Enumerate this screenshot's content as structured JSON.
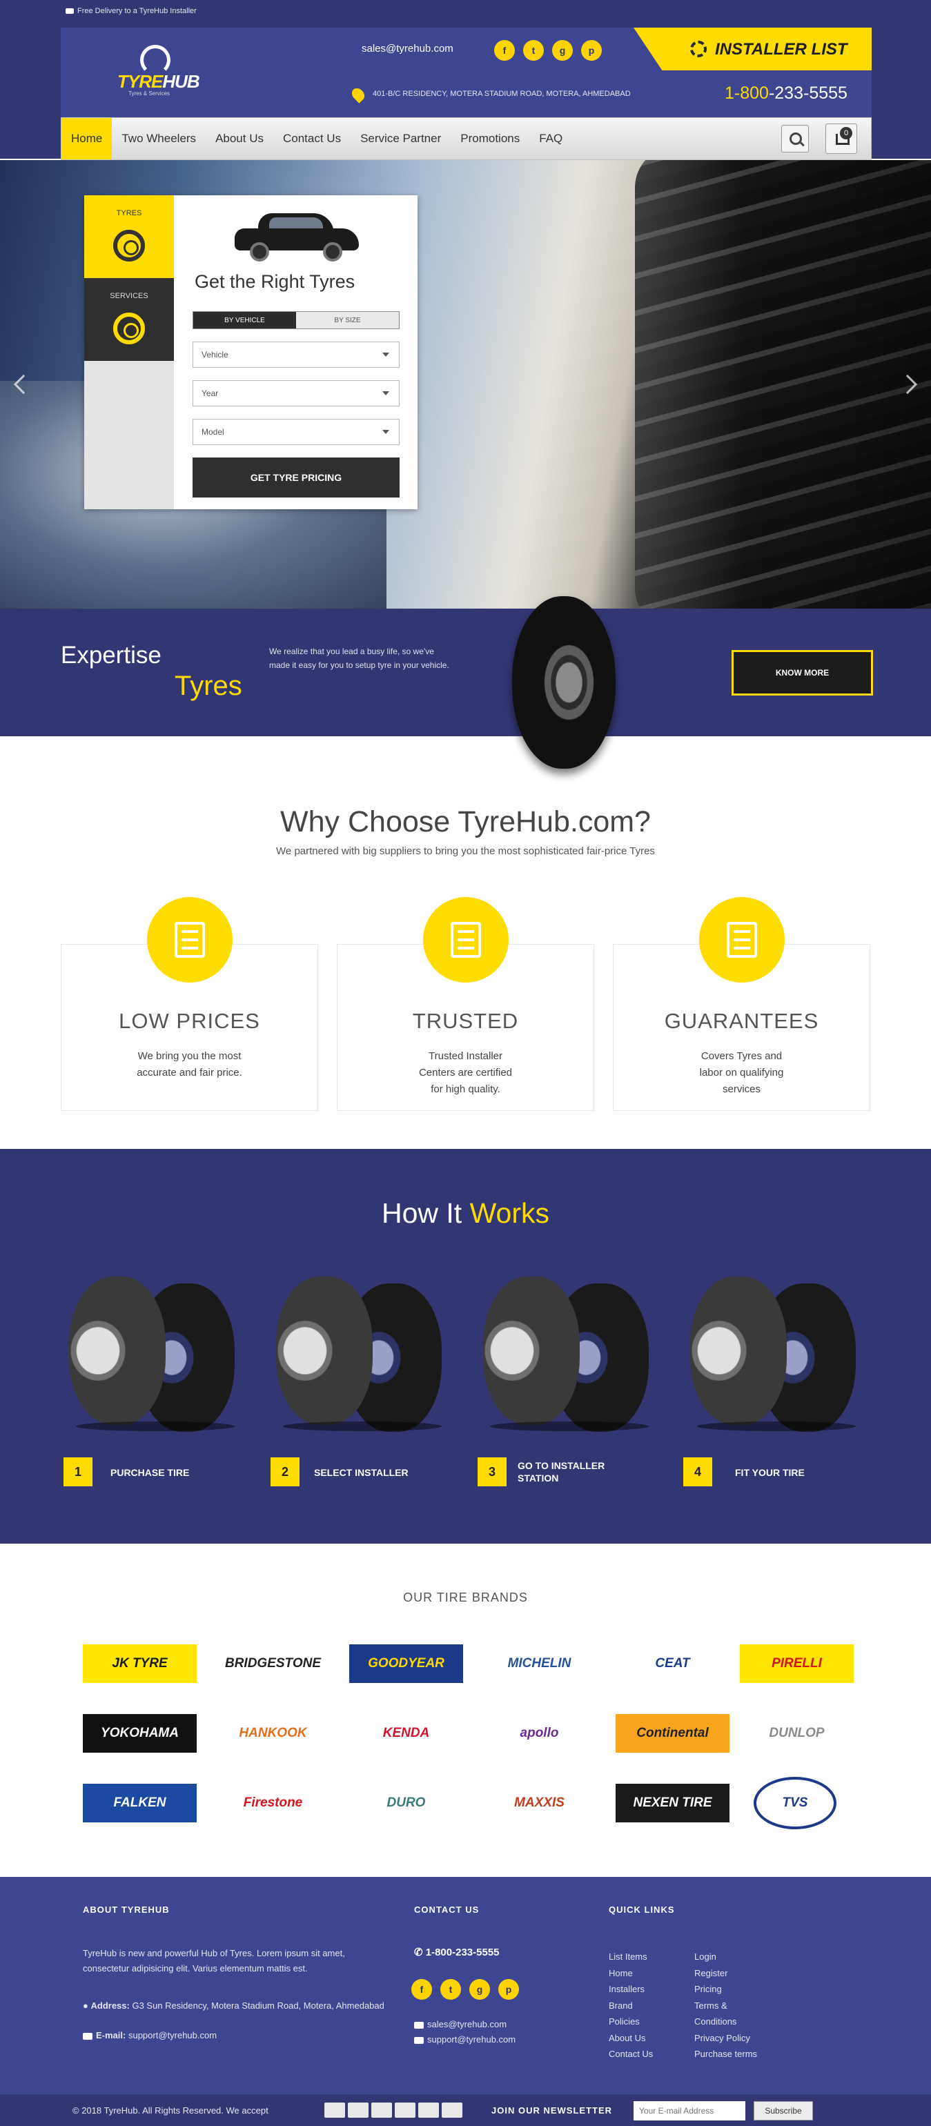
{
  "topbar": {
    "notice": "Free Delivery to a TyreHub Installer"
  },
  "header": {
    "logo_text_a": "TYRE",
    "logo_text_b": "HUB",
    "logo_tagline": "Tyres & Services",
    "email": "sales@tyrehub.com",
    "social": [
      {
        "icon": "facebook-icon",
        "glyph": "f"
      },
      {
        "icon": "twitter-icon",
        "glyph": "t"
      },
      {
        "icon": "google-plus-icon",
        "glyph": "g"
      },
      {
        "icon": "pinterest-icon",
        "glyph": "p"
      }
    ],
    "installer_label": "INSTALLER LIST",
    "address": "401-B/C RESIDENCY, MOTERA STADIUM ROAD, MOTERA, AHMEDABAD",
    "phone_prefix": "1-800",
    "phone_rest": "-233-5555"
  },
  "nav": {
    "items": [
      "Home",
      "Two Wheelers",
      "About Us",
      "Contact Us",
      "Service Partner",
      "Promotions",
      "FAQ"
    ],
    "active": "Home",
    "cart_count": "0"
  },
  "finder": {
    "tab_tyres": "TYRES",
    "tab_services": "SERVICES",
    "title": "Get the Right Tyres",
    "seg_vehicle": "BY VEHICLE",
    "seg_size": "BY SIZE",
    "select_vehicle": "Vehicle",
    "select_year": "Year",
    "select_model": "Model",
    "button": "GET TYRE PRICING"
  },
  "expertise": {
    "word1": "Expertise",
    "word2": "Tyres",
    "text": "We realize that you lead a busy life, so we've made it easy for you to setup tyre in your vehicle.",
    "button": "KNOW MORE"
  },
  "why": {
    "title": "Why Choose TyreHub.com?",
    "subtitle": "We partnered with big suppliers to bring you the most sophisticated fair-price Tyres",
    "features": [
      {
        "icon": "calculator-icon",
        "title": "LOW PRICES",
        "text": "We bring you the most accurate and fair price."
      },
      {
        "icon": "calendar-icon",
        "title": "TRUSTED",
        "text": "Trusted Installer Centers are certified for high quality."
      },
      {
        "icon": "certificate-icon",
        "title": "GUARANTEES",
        "text": "Covers Tyres and labor on qualifying services"
      }
    ]
  },
  "how": {
    "title_a": "How It ",
    "title_b": "Works",
    "steps": [
      {
        "num": "1",
        "label": "PURCHASE TIRE"
      },
      {
        "num": "2",
        "label": "SELECT INSTALLER"
      },
      {
        "num": "3",
        "label": "GO TO INSTALLER STATION"
      },
      {
        "num": "4",
        "label": "FIT YOUR TIRE"
      }
    ]
  },
  "brands": {
    "title": "OUR TIRE BRANDS",
    "items": [
      {
        "name": "JK TYRE",
        "bg": "#ffe600",
        "fg": "#1a1a1a"
      },
      {
        "name": "BRIDGESTONE",
        "bg": "#ffffff",
        "fg": "#222222"
      },
      {
        "name": "GOODYEAR",
        "bg": "#1d3a8a",
        "fg": "#ffdc00"
      },
      {
        "name": "MICHELIN",
        "bg": "#ffffff",
        "fg": "#27509b"
      },
      {
        "name": "CEAT",
        "bg": "#ffffff",
        "fg": "#1b3c8c"
      },
      {
        "name": "PIRELLI",
        "bg": "#ffe600",
        "fg": "#d4141a"
      },
      {
        "name": "YOKOHAMA",
        "bg": "#111111",
        "fg": "#ffffff"
      },
      {
        "name": "HANKOOK",
        "bg": "#ffffff",
        "fg": "#e46f1b"
      },
      {
        "name": "KENDA",
        "bg": "#ffffff",
        "fg": "#d3122a"
      },
      {
        "name": "apollo",
        "bg": "#ffffff",
        "fg": "#6a2c91"
      },
      {
        "name": "Continental",
        "bg": "#f7a51c",
        "fg": "#222222"
      },
      {
        "name": "DUNLOP",
        "bg": "#ffffff",
        "fg": "#8a8a8a"
      },
      {
        "name": "FALKEN",
        "bg": "#1b4aa0",
        "fg": "#ffffff"
      },
      {
        "name": "Firestone",
        "bg": "#ffffff",
        "fg": "#d4141a"
      },
      {
        "name": "DURO",
        "bg": "#ffffff",
        "fg": "#3a7a7a"
      },
      {
        "name": "MAXXIS",
        "bg": "#ffffff",
        "fg": "#c43d1b"
      },
      {
        "name": "NEXEN TIRE",
        "bg": "#1a1a1a",
        "fg": "#ffffff"
      },
      {
        "name": "TVS",
        "bg": "#ffffff",
        "fg": "#1d3a8a"
      }
    ]
  },
  "footer": {
    "about_title": "ABOUT TYREHUB",
    "about_text": "TyreHub is new and powerful Hub of Tyres. Lorem ipsum sit amet, consectetur adipisicing elit. Varius elementum mattis est.",
    "address_label": "Address:",
    "address": "G3 Sun Residency, Motera Stadium Road, Motera, Ahmedabad",
    "email_label": "E-mail:",
    "email": "support@tyrehub.com",
    "contact_title": "CONTACT US",
    "contact_phone": "1-800-233-5555",
    "contact_mail1": "sales@tyrehub.com",
    "contact_mail2": "support@tyrehub.com",
    "links_title": "QUICK LINKS",
    "links_col1": [
      "List Items",
      "Home",
      "Installers",
      "Brand",
      "Policies",
      "About Us",
      "Contact Us"
    ],
    "links_col2": [
      "Login",
      "Register",
      "Pricing",
      "Terms &",
      "Conditions",
      "Privacy Policy",
      "Purchase terms"
    ],
    "copyright": "© 2018 TyreHub. All Rights Reserved. We accept",
    "newsletter_label": "JOIN OUR NEWSLETTER",
    "newsletter_placeholder": "Your E-mail Address",
    "newsletter_button": "Subscribe"
  }
}
